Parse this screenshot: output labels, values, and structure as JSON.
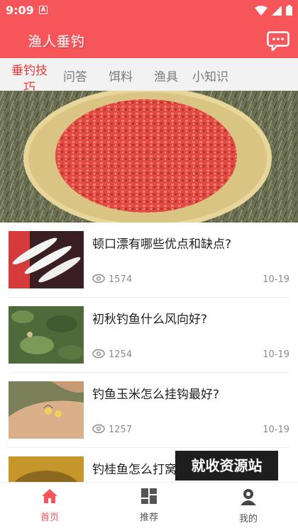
{
  "status_bar": {
    "time": "9:09",
    "notification_letter": "A"
  },
  "header": {
    "app_title": "渔人垂钓",
    "chat_icon": "chat-bubble-icon"
  },
  "tabs": [
    {
      "label_line1": "垂钓技",
      "label_line2": "巧",
      "active": true
    },
    {
      "label": "问答"
    },
    {
      "label": "饵料"
    },
    {
      "label": "渔具"
    },
    {
      "label": "小知识"
    }
  ],
  "articles": [
    {
      "title": "顿口漂有哪些优点和缺点?",
      "views": "1574",
      "date": "10-19"
    },
    {
      "title": "初秋钓鱼什么风向好?",
      "views": "1254",
      "date": "10-19"
    },
    {
      "title": "钓鱼玉米怎么挂钩最好?",
      "views": "1257",
      "date": "10-19"
    },
    {
      "title": "钓桂鱼怎么打窝",
      "views": "",
      "date": ""
    }
  ],
  "watermark": "就收资源站",
  "bottom_nav": [
    {
      "label": "首页",
      "icon": "home-icon",
      "active": true
    },
    {
      "label": "推荐",
      "icon": "grid-icon"
    },
    {
      "label": "我的",
      "icon": "user-icon"
    }
  ],
  "colors": {
    "accent": "#f6565a",
    "tab_active": "#e83a3a"
  }
}
